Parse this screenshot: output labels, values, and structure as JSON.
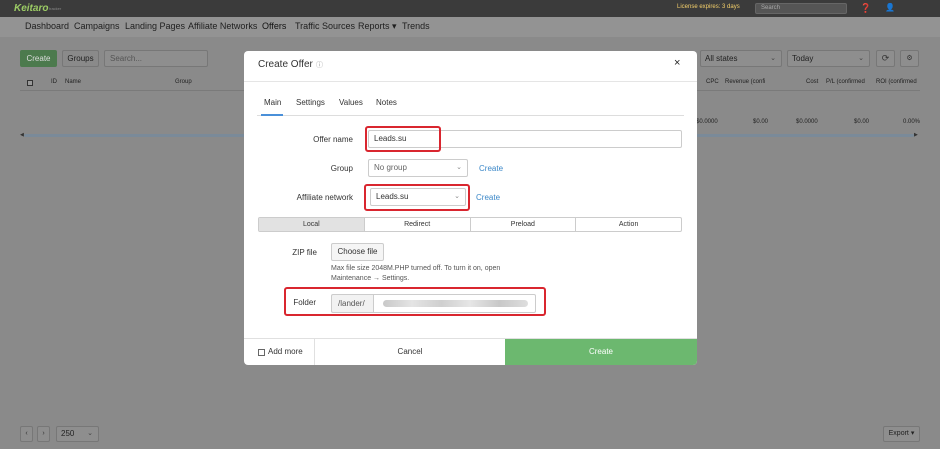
{
  "app": {
    "logo": "Keitaro",
    "logo_sub": "tracker",
    "license_text": "License expires: 3 days",
    "search_placeholder": "Search",
    "help_icon": "help-icon",
    "user_icon": "user-icon"
  },
  "nav": {
    "items": [
      "Dashboard",
      "Campaigns",
      "Landing Pages",
      "Affiliate Networks",
      "Offers",
      "Traffic Sources",
      "Reports ▾",
      "Trends"
    ],
    "active": "Offers"
  },
  "toolbar": {
    "create_label": "Create",
    "groups_label": "Groups",
    "search_placeholder": "Search...",
    "states_value": "All states",
    "date_value": "Today"
  },
  "table": {
    "columns_left": [
      "ID",
      "Name",
      "Group"
    ],
    "columns_right": [
      "CPC",
      "Revenue (confi",
      "Cost",
      "P/L (confirmed",
      "ROI (confirmed"
    ],
    "totals": [
      "$0.0000",
      "$0.00",
      "$0.0000",
      "$0.00",
      "0.00%"
    ]
  },
  "footer": {
    "page_size": "250",
    "export_label": "Export ▾"
  },
  "modal": {
    "title": "Create Offer",
    "close": "×",
    "tabs": [
      "Main",
      "Settings",
      "Values",
      "Notes"
    ],
    "active_tab": "Main",
    "offer_name_label": "Offer name",
    "offer_name_value": "Leads.su",
    "group_label": "Group",
    "group_value": "No group",
    "group_create_link": "Create",
    "affiliate_label": "Affiliate network",
    "affiliate_value": "Leads.su",
    "affiliate_create_link": "Create",
    "types": [
      "Local",
      "Redirect",
      "Preload",
      "Action"
    ],
    "active_type": "Local",
    "zip_label": "ZIP file",
    "choose_file_label": "Choose file",
    "zip_help": "Max file size 2048M.PHP turned off. To turn it on, open Maintenance → Settings.",
    "folder_label": "Folder",
    "folder_prefix": "/lander/",
    "add_more_label": "Add more",
    "cancel_label": "Cancel",
    "create_label": "Create"
  },
  "colors": {
    "accent_green": "#6cb86f",
    "link_blue": "#3a87c8",
    "highlight_red": "#d9262f"
  }
}
